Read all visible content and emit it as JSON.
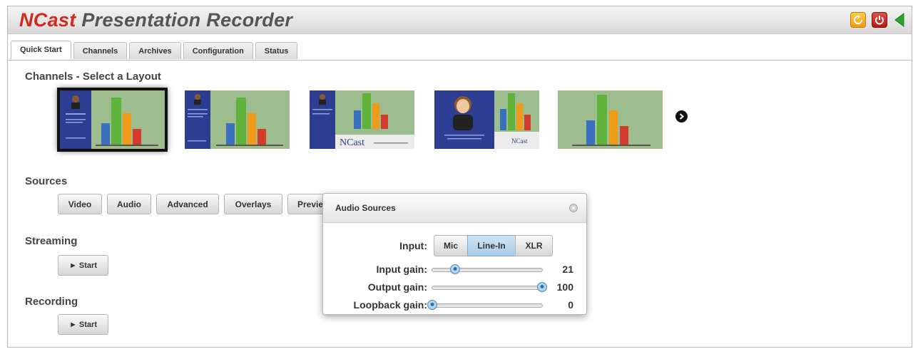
{
  "app": {
    "title_brand": "NCast",
    "title_rest": " Presentation Recorder"
  },
  "header_icons": [
    {
      "icon": "refresh-icon",
      "color": "#f2a51b"
    },
    {
      "icon": "power-icon",
      "color": "#c8261c"
    },
    {
      "icon": "back-arrow-icon",
      "color": "#2fa12f"
    }
  ],
  "tabs": [
    {
      "label": "Quick Start",
      "active": true
    },
    {
      "label": "Channels",
      "active": false
    },
    {
      "label": "Archives",
      "active": false
    },
    {
      "label": "Configuration",
      "active": false
    },
    {
      "label": "Status",
      "active": false
    }
  ],
  "channels": {
    "heading": "Channels - Select a Layout",
    "layouts": [
      {
        "style": "sidebar-presenter",
        "selected": true
      },
      {
        "style": "sidebar-presenter-text",
        "selected": false
      },
      {
        "style": "sidebar-logo-banner",
        "selected": false
      },
      {
        "style": "large-presenter",
        "selected": false
      },
      {
        "style": "slides-only",
        "selected": false
      }
    ],
    "logo_text": "NCast",
    "next_icon": "chevron-right-icon"
  },
  "sources": {
    "heading": "Sources",
    "buttons": [
      "Video",
      "Audio",
      "Advanced",
      "Overlays",
      "Preview"
    ]
  },
  "streaming": {
    "heading": "Streaming",
    "start_label": "► Start"
  },
  "recording": {
    "heading": "Recording",
    "start_label": "► Start"
  },
  "audio_dialog": {
    "title": "Audio Sources",
    "input_label": "Input:",
    "inputs": [
      {
        "label": "Mic",
        "selected": false
      },
      {
        "label": "Line-In",
        "selected": true
      },
      {
        "label": "XLR",
        "selected": false
      }
    ],
    "input_gain": {
      "label": "Input gain:",
      "value": "21",
      "level": 0.21
    },
    "output_gain": {
      "label": "Output gain:",
      "value": "100",
      "level": 1.0
    },
    "loopback_gain": {
      "label": "Loopback gain:",
      "value": "0",
      "level": 0.0
    }
  },
  "colors": {
    "brand_red": "#d4281c",
    "selected_blue": "#a9cde8",
    "slide_green": "#9dbd8e",
    "panel_blue": "#2d3d92"
  }
}
